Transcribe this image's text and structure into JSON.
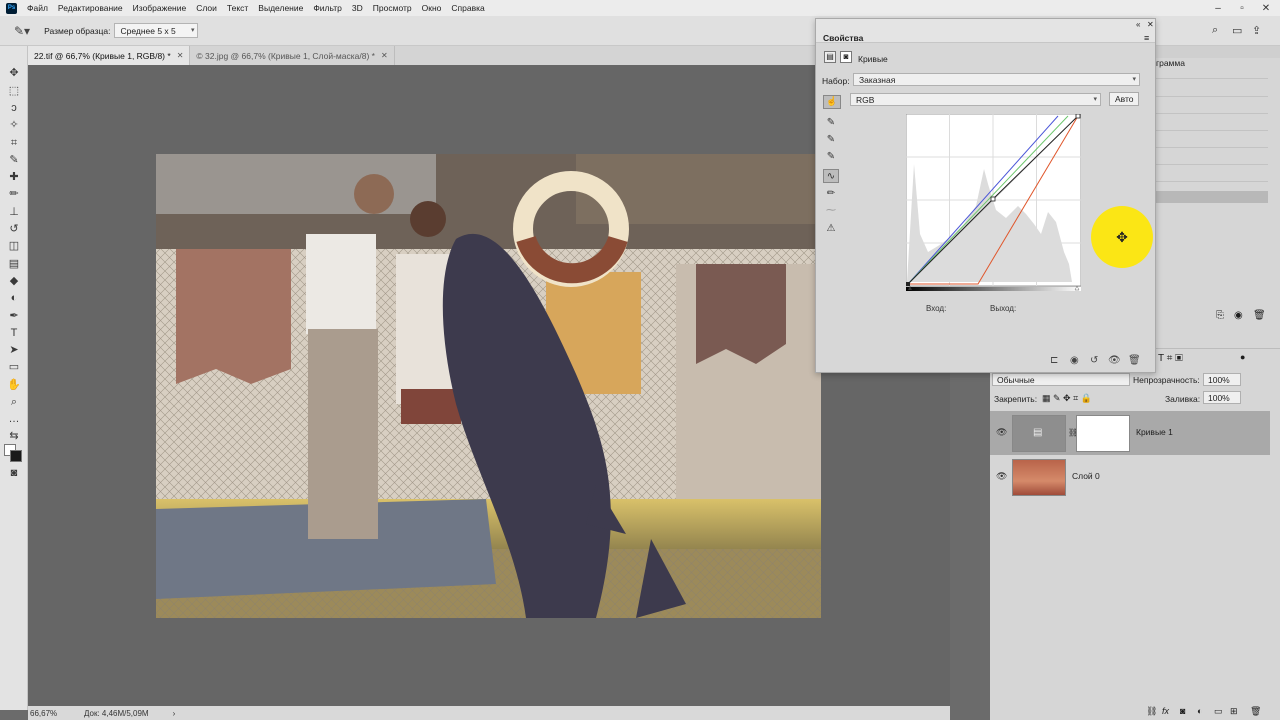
{
  "app": {
    "logo": "Ps"
  },
  "menu": [
    "Файл",
    "Редактирование",
    "Изображение",
    "Слои",
    "Текст",
    "Выделение",
    "Фильтр",
    "3D",
    "Просмотр",
    "Окно",
    "Справка"
  ],
  "options": {
    "sample_size_label": "Размер образца:",
    "sample_size_value": "Среднее 5 х 5"
  },
  "tabs": [
    {
      "label": "22.tif @ 66,7% (Кривые 1, RGB/8) *",
      "active": true
    },
    {
      "label": "© 32.jpg @ 66,7% (Кривые 1, Слой-маска/8) *",
      "active": false
    }
  ],
  "status": {
    "zoom": "66,67%",
    "doc": "Док: 4,46М/5,09М"
  },
  "dock": {
    "history_tab": "грамма"
  },
  "properties": {
    "title": "Свойства",
    "subtitle": "Кривые",
    "preset_label": "Набор:",
    "preset_value": "Заказная",
    "channel_value": "RGB",
    "auto_button": "Авто",
    "input_label": "Вход:",
    "output_label": "Выход:"
  },
  "layers": {
    "blend_mode": "Обычные",
    "opacity_label": "Непрозрачность:",
    "opacity_value": "100%",
    "lock_label": "Закрепить:",
    "fill_label": "Заливка:",
    "fill_value": "100%",
    "items": [
      {
        "name": "Кривые 1",
        "selected": true
      },
      {
        "name": "Слой 0",
        "selected": false
      }
    ]
  },
  "colors": {
    "accent_highlight": "#ffe800",
    "ps_blue": "#31a8ff"
  }
}
